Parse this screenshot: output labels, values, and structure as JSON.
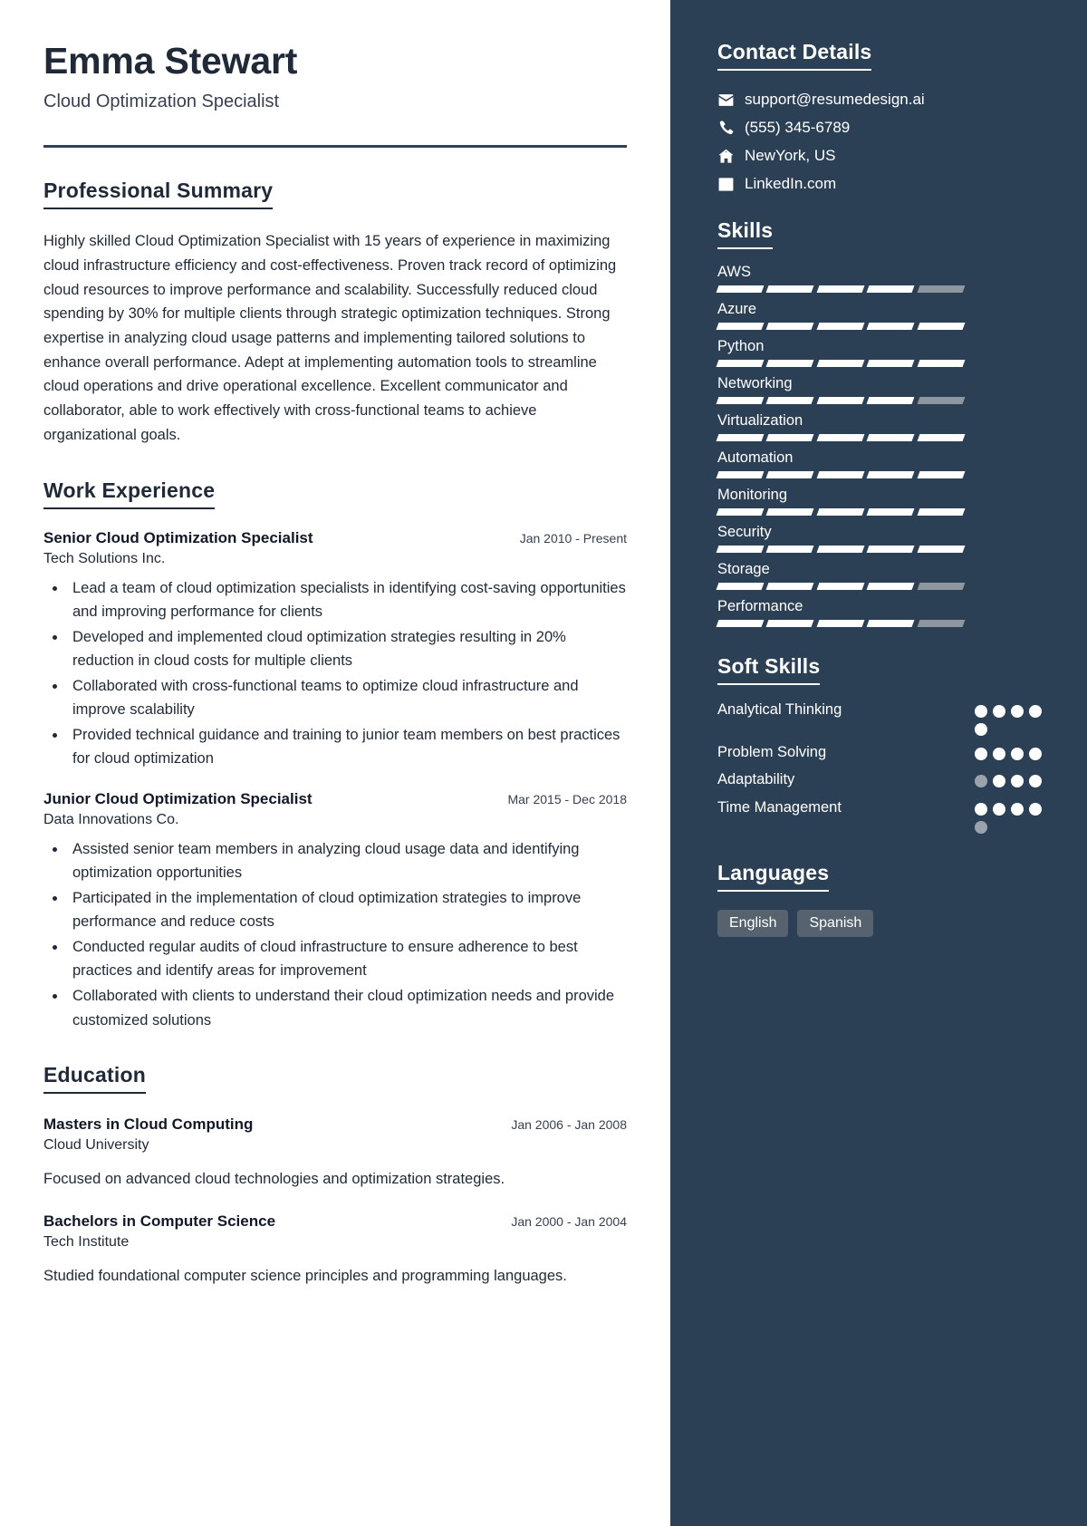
{
  "header": {
    "name": "Emma Stewart",
    "job_title": "Cloud Optimization Specialist"
  },
  "colors": {
    "sidebar_bg": "#2c4055",
    "text_dark": "#1f2937",
    "rule": "#2e4156",
    "chip_bg": "#56626e",
    "segment_off": "#8e97a0",
    "dot_off": "#9aa3ab"
  },
  "summary": {
    "title": "Professional Summary",
    "text": "Highly skilled Cloud Optimization Specialist with 15 years of experience in maximizing cloud infrastructure efficiency and cost-effectiveness. Proven track record of optimizing cloud resources to improve performance and scalability. Successfully reduced cloud spending by 30% for multiple clients through strategic optimization techniques. Strong expertise in analyzing cloud usage patterns and implementing tailored solutions to enhance overall performance. Adept at implementing automation tools to streamline cloud operations and drive operational excellence. Excellent communicator and collaborator, able to work effectively with cross-functional teams to achieve organizational goals."
  },
  "work_experience": {
    "title": "Work Experience",
    "jobs": [
      {
        "role": "Senior Cloud Optimization Specialist",
        "dates": "Jan 2010 - Present",
        "company": "Tech Solutions Inc.",
        "bullets": [
          "Lead a team of cloud optimization specialists in identifying cost-saving opportunities and improving performance for clients",
          "Developed and implemented cloud optimization strategies resulting in 20% reduction in cloud costs for multiple clients",
          "Collaborated with cross-functional teams to optimize cloud infrastructure and improve scalability",
          "Provided technical guidance and training to junior team members on best practices for cloud optimization"
        ]
      },
      {
        "role": "Junior Cloud Optimization Specialist",
        "dates": "Mar 2015 - Dec 2018",
        "company": "Data Innovations Co.",
        "bullets": [
          "Assisted senior team members in analyzing cloud usage data and identifying optimization opportunities",
          "Participated in the implementation of cloud optimization strategies to improve performance and reduce costs",
          "Conducted regular audits of cloud infrastructure to ensure adherence to best practices and identify areas for improvement",
          "Collaborated with clients to understand their cloud optimization needs and provide customized solutions"
        ]
      }
    ]
  },
  "education": {
    "title": "Education",
    "entries": [
      {
        "degree": "Masters in Cloud Computing",
        "dates": "Jan 2006 - Jan 2008",
        "school": "Cloud University",
        "description": "Focused on advanced cloud technologies and optimization strategies."
      },
      {
        "degree": "Bachelors in Computer Science",
        "dates": "Jan 2000 - Jan 2004",
        "school": "Tech Institute",
        "description": "Studied foundational computer science principles and programming languages."
      }
    ]
  },
  "contact": {
    "title": "Contact Details",
    "items": [
      {
        "icon": "envelope-icon",
        "value": "support@resumedesign.ai"
      },
      {
        "icon": "phone-icon",
        "value": "(555) 345-6789"
      },
      {
        "icon": "home-icon",
        "value": "NewYork, US"
      },
      {
        "icon": "linkedin-icon",
        "value": "LinkedIn.com"
      }
    ]
  },
  "skills": {
    "title": "Skills",
    "total_segments": 5,
    "items": [
      {
        "name": "AWS",
        "filled": 4
      },
      {
        "name": "Azure",
        "filled": 5
      },
      {
        "name": "Python",
        "filled": 5
      },
      {
        "name": "Networking",
        "filled": 4
      },
      {
        "name": "Virtualization",
        "filled": 5
      },
      {
        "name": "Automation",
        "filled": 5
      },
      {
        "name": "Monitoring",
        "filled": 5
      },
      {
        "name": "Security",
        "filled": 5
      },
      {
        "name": "Storage",
        "filled": 4
      },
      {
        "name": "Performance",
        "filled": 4
      }
    ]
  },
  "soft_skills": {
    "title": "Soft Skills",
    "total_dots": 5,
    "items": [
      {
        "name": "Analytical Thinking",
        "filled": 5,
        "pattern": [
          "on",
          "on",
          "on",
          "on",
          "on"
        ]
      },
      {
        "name": "Problem Solving",
        "filled": 4,
        "pattern": [
          "on",
          "on",
          "on",
          "on"
        ]
      },
      {
        "name": "Adaptability",
        "filled": 3,
        "pattern": [
          "off",
          "on",
          "on",
          "on"
        ]
      },
      {
        "name": "Time Management",
        "filled": 4,
        "pattern": [
          "on",
          "on",
          "on",
          "on",
          "off"
        ]
      }
    ]
  },
  "languages": {
    "title": "Languages",
    "items": [
      "English",
      "Spanish"
    ]
  }
}
